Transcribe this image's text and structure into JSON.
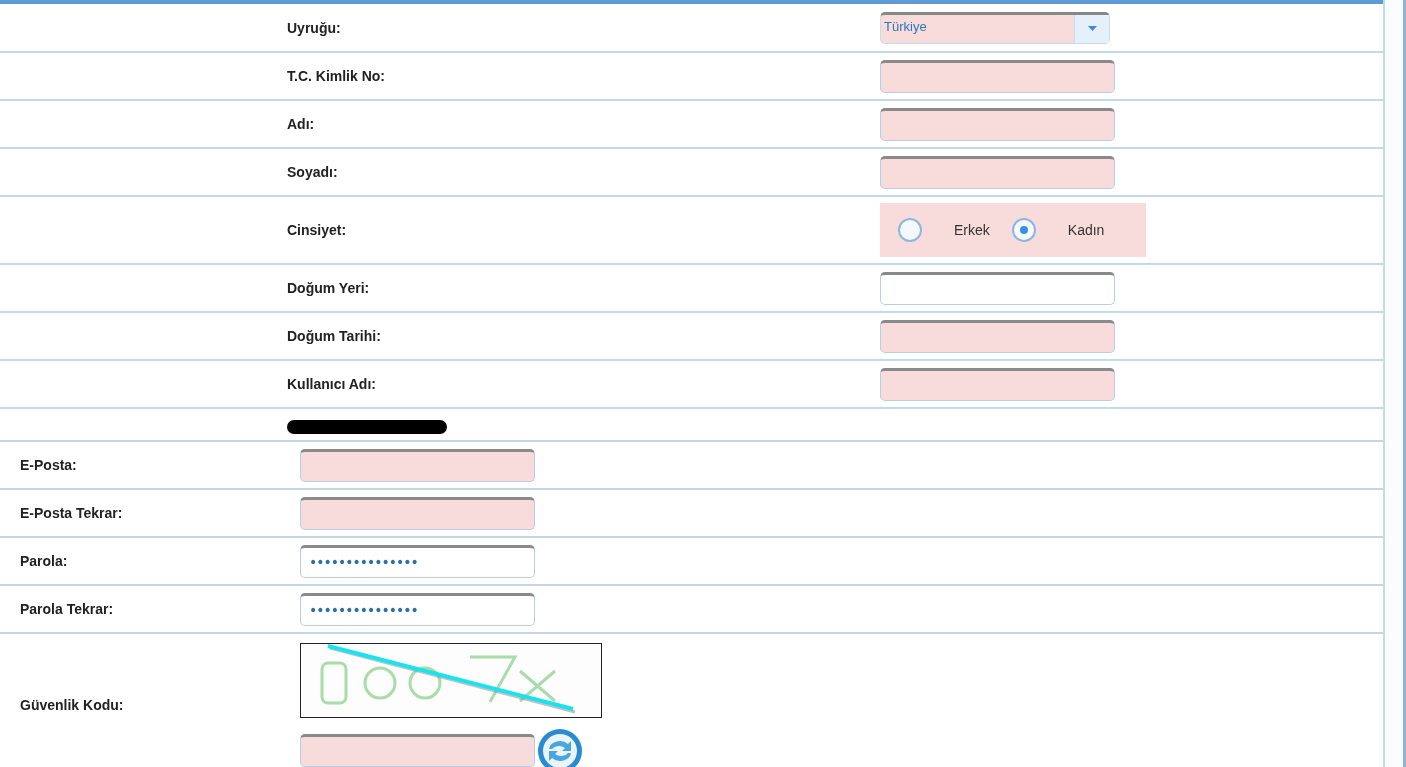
{
  "personal_rows": [
    {
      "label": "Uyruğu:",
      "kind": "select",
      "value": "Türkiye",
      "highlighted": true
    },
    {
      "label": "T.C. Kimlik No:",
      "kind": "text",
      "highlighted": true
    },
    {
      "label": "Adı:",
      "kind": "text",
      "highlighted": true
    },
    {
      "label": "Soyadı:",
      "kind": "text",
      "highlighted": true
    },
    {
      "label": "Cinsiyet:",
      "kind": "radio",
      "highlighted": true,
      "options": [
        {
          "label": "Erkek",
          "selected": false
        },
        {
          "label": "Kadın",
          "selected": true
        }
      ]
    },
    {
      "label": "Doğum Yeri:",
      "kind": "text",
      "highlighted": false
    },
    {
      "label": "Doğum Tarihi:",
      "kind": "text",
      "highlighted": true
    },
    {
      "label": "Kullanıcı Adı:",
      "kind": "text",
      "highlighted": true
    }
  ],
  "account_rows": [
    {
      "label": "E-Posta:",
      "highlighted": true
    },
    {
      "label": "E-Posta Tekrar:",
      "highlighted": true
    },
    {
      "label": "Parola:",
      "value": "•••••••••••••••",
      "highlighted": false
    },
    {
      "label": "Parola Tekrar:",
      "value": "•••••••••••••••",
      "highlighted": false
    }
  ],
  "captcha": {
    "label": "Güvenlik Kodu:",
    "highlighted": true
  }
}
